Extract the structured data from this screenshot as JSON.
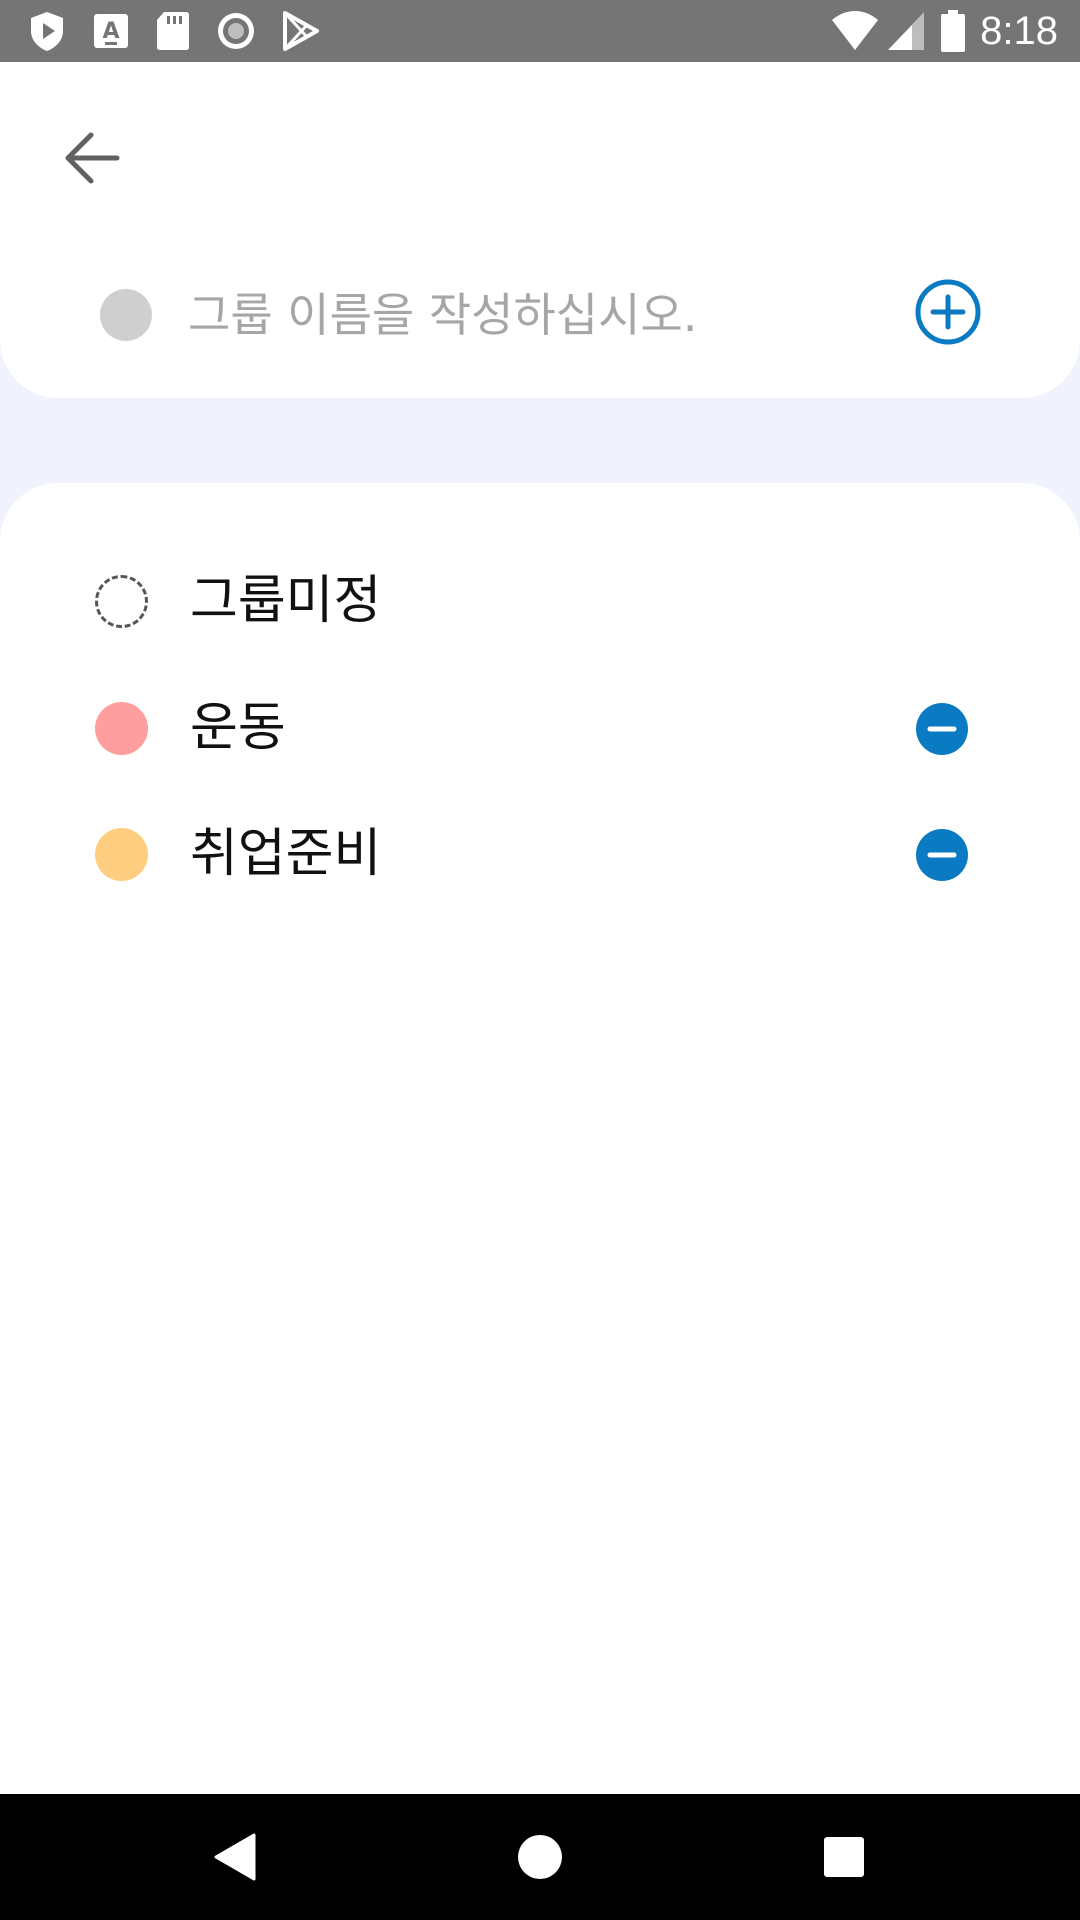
{
  "status_bar": {
    "time": "8:18",
    "left_icons": [
      "shield-play-icon",
      "font-icon",
      "sd-card-icon",
      "record-icon",
      "play-store-icon"
    ],
    "right_icons": [
      "wifi-icon",
      "signal-icon",
      "battery-icon"
    ]
  },
  "header": {
    "back_icon": "arrow-left-icon"
  },
  "new_group": {
    "placeholder": "그룹 이름을 작성하십시오.",
    "value": "",
    "dot_color": "#cfcfcf",
    "add_icon": "plus-circle-icon",
    "accent_color": "#0a7bc2"
  },
  "groups": [
    {
      "label": "그룹미정",
      "color": "none",
      "style": "dashed",
      "removable": false
    },
    {
      "label": "운동",
      "color": "#ff9e9e",
      "style": "solid",
      "removable": true
    },
    {
      "label": "취업준비",
      "color": "#ffcd7f",
      "style": "solid",
      "removable": true
    }
  ],
  "nav_bar": {
    "icons": [
      "back-triangle-icon",
      "home-circle-icon",
      "recents-square-icon"
    ]
  }
}
